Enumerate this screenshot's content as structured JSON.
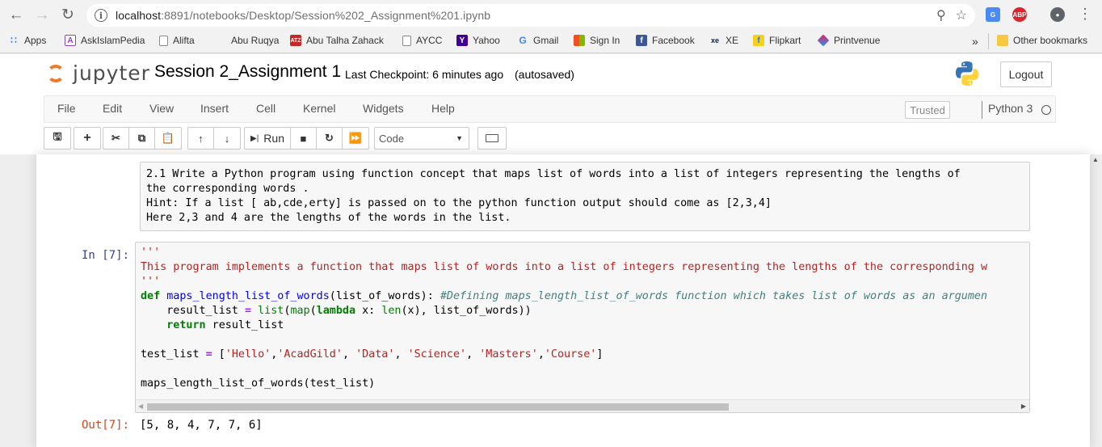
{
  "browser": {
    "url_host": "localhost",
    "url_path": ":8891/notebooks/Desktop/Session%202_Assignment%201.ipynb",
    "bookmarks": [
      {
        "label": "Apps",
        "icon": "apps-grid-icon",
        "color": "#4285f4"
      },
      {
        "label": "AskIslamPedia",
        "icon": "askislampedia-icon",
        "color": "#8e44ad"
      },
      {
        "label": "Alifta",
        "icon": "page-icon",
        "color": "#9e9e9e"
      },
      {
        "label": "Abu Ruqya",
        "icon": "page-icon",
        "color": "#ffffff"
      },
      {
        "label": "Abu Talha Zahack",
        "icon": "atz-icon",
        "color": "#c62828"
      },
      {
        "label": "AYCC",
        "icon": "page-icon",
        "color": "#9e9e9e"
      },
      {
        "label": "Yahoo",
        "icon": "yahoo-icon",
        "color": "#410093"
      },
      {
        "label": "Gmail",
        "icon": "google-icon",
        "color": "#4285f4"
      },
      {
        "label": "Sign In",
        "icon": "microsoft-icon",
        "color": "#f25022"
      },
      {
        "label": "Facebook",
        "icon": "facebook-icon",
        "color": "#3b5998"
      },
      {
        "label": "XE",
        "icon": "xe-icon",
        "color": "#0a1f44"
      },
      {
        "label": "Flipkart",
        "icon": "flipkart-icon",
        "color": "#f7d117"
      },
      {
        "label": "Printvenue",
        "icon": "printvenue-icon",
        "color": "#e91e63"
      }
    ],
    "overflow_label": "»",
    "other_bookmarks": "Other bookmarks"
  },
  "jupyter": {
    "logo_text": "jupyter",
    "notebook_title": "Session 2_Assignment 1",
    "checkpoint": "Last Checkpoint: 6 minutes ago",
    "autosaved": "(autosaved)",
    "logout": "Logout",
    "menu": [
      "File",
      "Edit",
      "View",
      "Insert",
      "Cell",
      "Kernel",
      "Widgets",
      "Help"
    ],
    "trusted": "Trusted",
    "kernel": "Python 3",
    "run_label": "Run",
    "cell_type": "Code"
  },
  "markdown_cell": {
    "lines": [
      "2.1 Write a Python program using function concept that maps list of words into a list of integers representing the lengths of",
      "the corresponding words .",
      "Hint: If a list [ ab,cde,erty] is passed on to the python function output should come as [2,3,4]",
      "Here 2,3 and 4 are the lengths of the words in the list."
    ]
  },
  "code_cell": {
    "prompt_in": "In [7]:",
    "prompt_out": "Out[7]:",
    "docstring_open": "'''",
    "docstring_text": "This program implements a function that maps list of words into a list of integers representing the lengths of the corresponding w",
    "docstring_close": "'''",
    "def_kw": "def",
    "func_name": "maps_length_list_of_words",
    "def_args": "(list_of_words): ",
    "def_comment": "#Defining maps_length_list_of_words function which takes list of words as an argumen",
    "line2_indent": "    result_list ",
    "line2_eq": "=",
    "line2_sp": " ",
    "line2_list": "list",
    "line2_p1": "(",
    "line2_map": "map",
    "line2_p2": "(",
    "line2_lambda": "lambda",
    "line2_x": " x: ",
    "line2_len": "len",
    "line2_rest": "(x), list_of_words))",
    "line3_indent": "    ",
    "line3_return": "return",
    "line3_rest": " result_list",
    "line5_name": "test_list ",
    "line5_eq": "=",
    "line5_open": " [",
    "line5_s1": "'Hello'",
    "line5_c1": ",",
    "line5_s2": "'AcadGild'",
    "line5_c2": ", ",
    "line5_s3": "'Data'",
    "line5_c3": ", ",
    "line5_s4": "'Science'",
    "line5_c4": ", ",
    "line5_s5": "'Masters'",
    "line5_c5": ",",
    "line5_s6": "'Course'",
    "line5_close": "]",
    "line7_call": "maps_length_list_of_words",
    "line7_rest": "(test_list)",
    "output": "[5, 8, 4, 7, 7, 6]"
  }
}
